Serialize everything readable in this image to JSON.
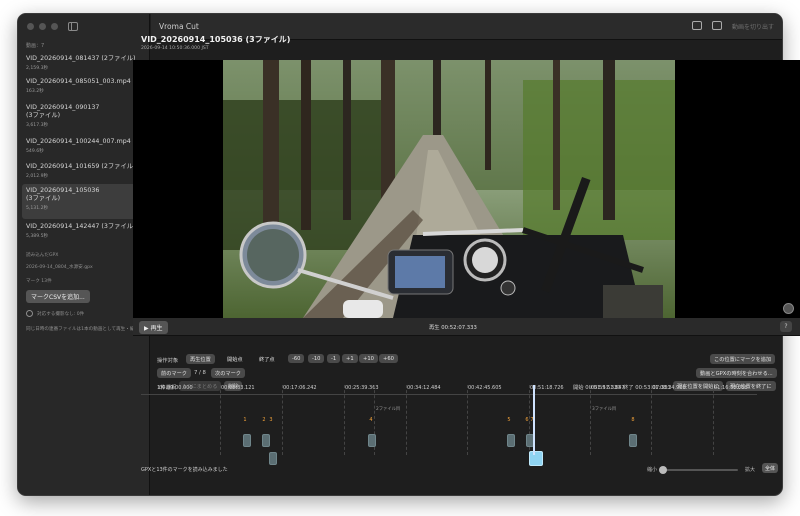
{
  "app": {
    "title": "Vroma Cut",
    "export_label": "動画を切り出す"
  },
  "sidebar": {
    "count": "動画：7",
    "videos": [
      {
        "name": "VID_20260914_081437 (2ファイル)",
        "size": "2,159.3秒"
      },
      {
        "name": "VID_20260914_085051_003.mp4",
        "size": "163.2秒"
      },
      {
        "name": "VID_20260914_090137\n(3ファイル)",
        "size": "3,617.3秒"
      },
      {
        "name": "VID_20260914_100244_007.mp4",
        "size": "549.6秒"
      },
      {
        "name": "VID_20260914_101659 (2ファイル)",
        "size": "2,012.9秒"
      },
      {
        "name": "VID_20260914_105036\n(3ファイル)",
        "size": "5,131.2秒"
      },
      {
        "name": "VID_20260914_142447 (3ファイル)",
        "size": "5,389.5秒"
      }
    ],
    "gpx_header": "読み込んだGPX",
    "gpx_file": "2026-09-14_0804_水源安.gpx",
    "marks_header": "マーク 13件",
    "add_csv_label": "マークCSVを追加...",
    "person_label": "対応する撮影なし: 0件",
    "note": "同じ日時の連番ファイルは1本の動画として再生・編..."
  },
  "main": {
    "video_title": "VID_20260914_105036 (3ファイル)",
    "video_date": "2026-09-14 10:50:36.000 JST",
    "play_label": "▶ 再生",
    "playback_time": "再生 00:52:07.333",
    "help": "?"
  },
  "operations": {
    "target_label": "操作対象",
    "target_buttons": [
      "再生位置",
      "開始点",
      "終了点"
    ],
    "step_buttons": [
      "-60",
      "-10",
      "-1",
      "+1",
      "+10",
      "+60"
    ],
    "add_mark_label": "この位置にマークを追加",
    "prev_mark": "前のマーク",
    "mark_pos": "7 / 8",
    "next_mark": "次のマーク",
    "sync_gpx_label": "動画とGPXの時刻を合わせる...",
    "selection_count": "1件選択",
    "merge_label": "1つにまとめる",
    "delete_label": "削除",
    "start_time": "開始 00:51:57.333",
    "end_time": "終了 00:53:07.333",
    "set_start_label": "現在位置を開始に",
    "set_end_label": "現在位置を終了に"
  },
  "timeline": {
    "ticks": [
      "00:00:00.000",
      "00:08:33.121",
      "00:17:06.242",
      "00:25:39.363",
      "00:34:12.484",
      "00:42:45.605",
      "00:51:18.726",
      "00:59:51.847",
      "01:08:24.968",
      "01:16:58.088"
    ],
    "file_labels": [
      "2ファイル目",
      "3ファイル目"
    ],
    "marks": [
      "1",
      "2",
      "3",
      "4",
      "5",
      "6",
      "7",
      "8"
    ]
  },
  "status": {
    "message": "GPXと13件のマークを読み込みました",
    "zoom_small": "縮小",
    "zoom_large": "拡大",
    "zoom_all": "全体"
  },
  "colors": {
    "mark": "#f2a23a",
    "selected_clip": "#8fd4f2",
    "clip": "#5b6e73"
  }
}
